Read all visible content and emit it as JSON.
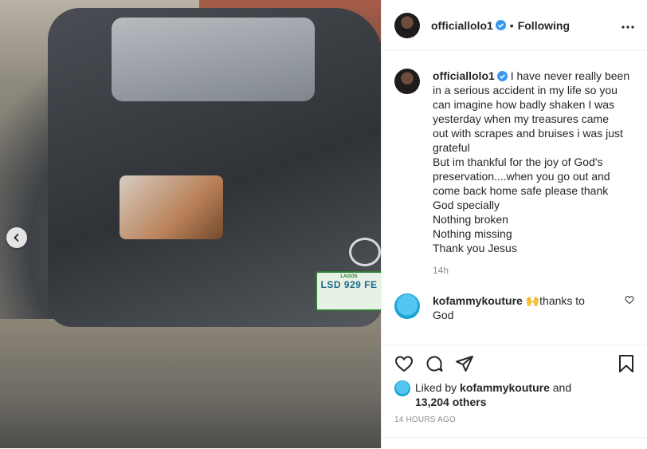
{
  "post": {
    "username": "officiallolo1",
    "follow_status": "Following",
    "dot": "•",
    "caption_lines": [
      "I have never really been",
      "in a serious accident in my life so you",
      "can imagine how badly shaken I was",
      "yesterday when my treasures came",
      "out with scrapes and bruises i was just",
      "grateful",
      "But im thankful for the joy of God's",
      "preservation....when you go out and",
      "come back home safe please thank",
      "God specially",
      "Nothing broken",
      "Nothing missing",
      "Thank you Jesus"
    ],
    "caption_age": "14h"
  },
  "comment": {
    "username": "kofammykouture",
    "emoji": "🙌",
    "text_1": "thanks to",
    "text_2": "God"
  },
  "likes": {
    "prefix": "Liked by",
    "liker": "kofammykouture",
    "and": "and",
    "count": "13,204 others"
  },
  "timestamp": "14 HOURS AGO",
  "photo": {
    "plate_text": "LSD 929 FE",
    "plate_state": "LAGOS"
  },
  "colors": {
    "verified": "#3897f0",
    "text": "#262626",
    "muted": "#8e8e8e"
  },
  "icons": [
    "chevron-left-icon",
    "verified-badge-icon",
    "more-icon",
    "heart-icon",
    "comment-icon",
    "share-icon",
    "bookmark-icon"
  ]
}
